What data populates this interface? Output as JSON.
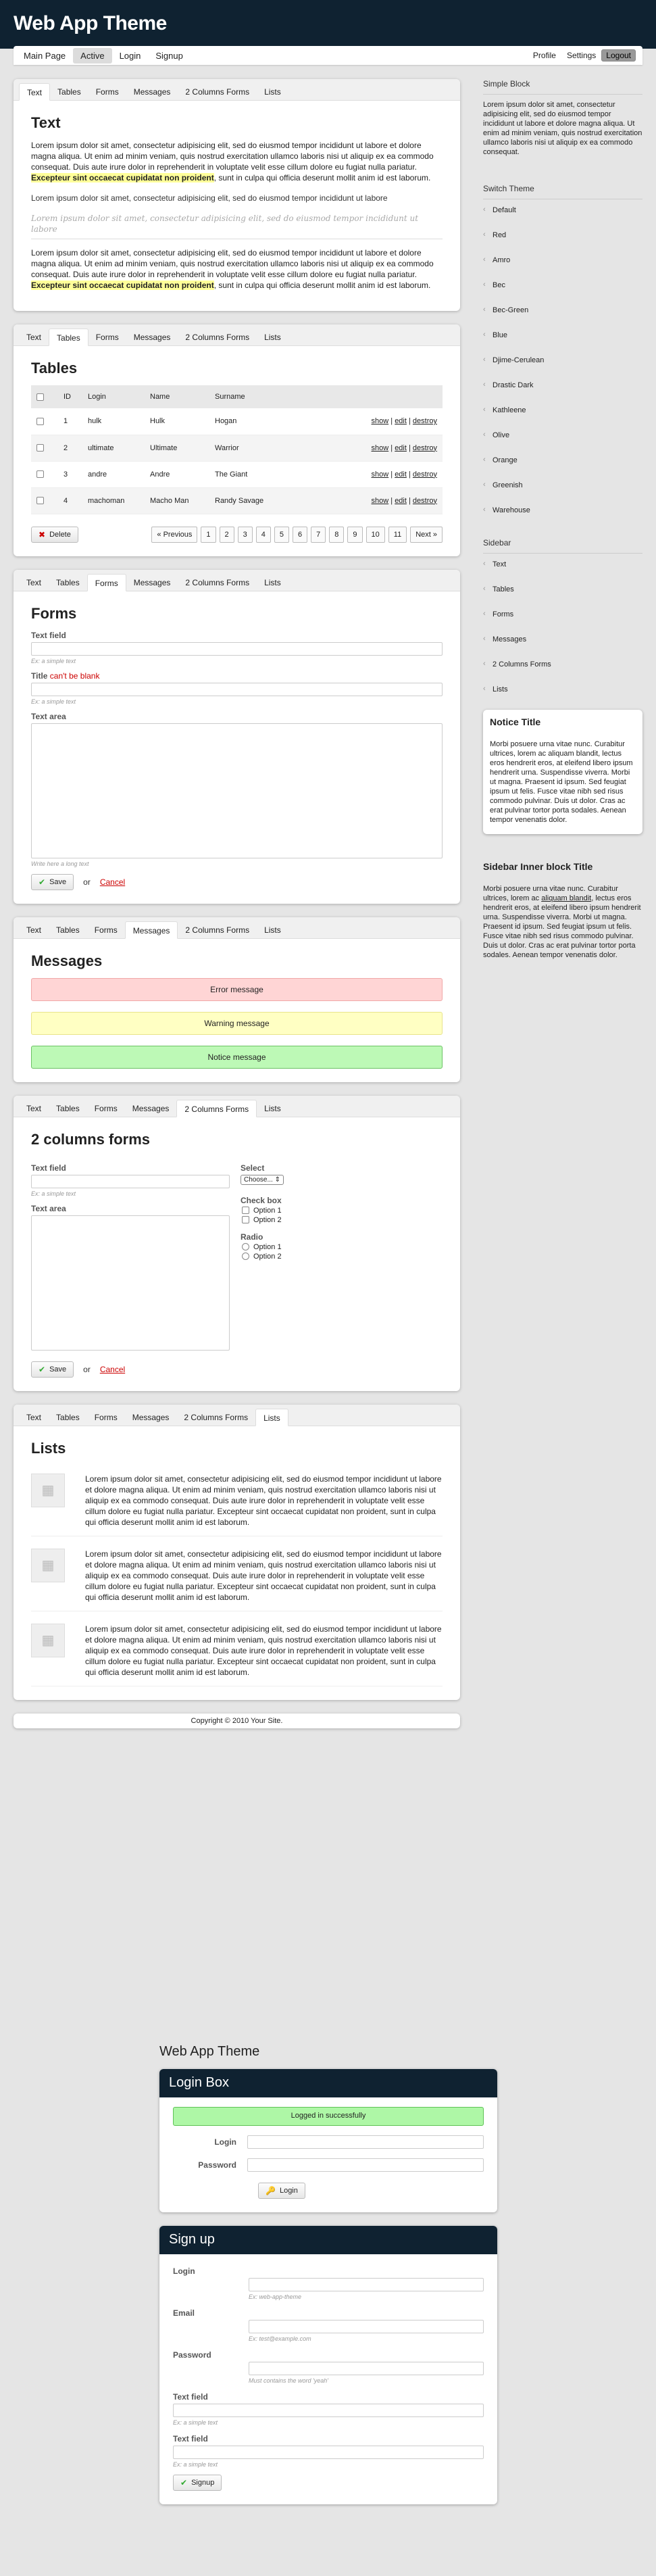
{
  "app_title": "Web App Theme",
  "topnav": {
    "items": [
      "Main Page",
      "Active",
      "Login",
      "Signup"
    ],
    "right": [
      "Profile",
      "Settings",
      "Logout"
    ]
  },
  "tabs": [
    "Text",
    "Tables",
    "Forms",
    "Messages",
    "2 Columns Forms",
    "Lists"
  ],
  "text_block": {
    "title": "Text",
    "p1a": "Lorem ipsum dolor sit amet, consectetur adipisicing elit, sed do eiusmod tempor incididunt ut labore et dolore magna aliqua. Ut enim ad minim veniam, quis nostrud exercitation ullamco laboris nisi ut aliquip ex ea commodo consequat. Duis aute irure dolor in reprehenderit in voluptate velit esse cillum dolore eu fugiat nulla pariatur. ",
    "p1hl": "Excepteur sint occaecat cupidatat non proident",
    "p1b": ", sunt in culpa qui officia deserunt mollit anim id est laborum.",
    "small": "Lorem ipsum dolor sit amet, consectetur adipisicing elit, sed do eiusmod tempor incididunt ut labore",
    "italic": "Lorem ipsum dolor sit amet, consectetur adipisicing elit, sed do eiusmod tempor incididunt ut labore",
    "p2a": "Lorem ipsum dolor sit amet, consectetur adipisicing elit, sed do eiusmod tempor incididunt ut labore et dolore magna aliqua. Ut enim ad minim veniam, quis nostrud exercitation ullamco laboris nisi ut aliquip ex ea commodo consequat. Duis aute irure dolor in reprehenderit in voluptate velit esse cillum dolore eu fugiat nulla pariatur. ",
    "p2hl": "Excepteur sint occaecat cupidatat non proident",
    "p2b": ", sunt in culpa qui officia deserunt mollit anim id est laborum."
  },
  "tables": {
    "title": "Tables",
    "headers": [
      "ID",
      "Login",
      "Name",
      "Surname"
    ],
    "rows": [
      [
        "1",
        "hulk",
        "Hulk",
        "Hogan"
      ],
      [
        "2",
        "ultimate",
        "Ultimate",
        "Warrior"
      ],
      [
        "3",
        "andre",
        "Andre",
        "The Giant"
      ],
      [
        "4",
        "machoman",
        "Macho Man",
        "Randy Savage"
      ]
    ],
    "actions": [
      "show",
      "edit",
      "destroy"
    ],
    "delete": "Delete",
    "pages": [
      "« Previous",
      "1",
      "2",
      "3",
      "4",
      "5",
      "6",
      "7",
      "8",
      "9",
      "10",
      "11",
      "Next »"
    ]
  },
  "forms": {
    "title": "Forms",
    "tf_label": "Text field",
    "tf_desc": "Ex: a simple text",
    "title_label": "Title",
    "title_err": "can't be blank",
    "title_desc": "Ex: a simple text",
    "ta_label": "Text area",
    "ta_desc": "Write here a long text",
    "save": "Save",
    "or": "or",
    "cancel": "Cancel"
  },
  "messages": {
    "title": "Messages",
    "error": "Error message",
    "warning": "Warning message",
    "notice": "Notice message"
  },
  "twocol": {
    "title": "2 columns forms",
    "tf_label": "Text field",
    "tf_desc": "Ex: a simple text",
    "ta_label": "Text area",
    "select_label": "Select",
    "select_value": "Choose... ⇕",
    "check_label": "Check box",
    "check_opts": [
      "Option 1",
      "Option 2"
    ],
    "radio_label": "Radio",
    "radio_opts": [
      "Option 1",
      "Option 2"
    ],
    "save": "Save",
    "or": "or",
    "cancel": "Cancel"
  },
  "lists": {
    "title": "Lists",
    "text": "Lorem ipsum dolor sit amet, consectetur adipisicing elit, sed do eiusmod tempor incididunt ut labore et dolore magna aliqua. Ut enim ad minim veniam, quis nostrud exercitation ullamco laboris nisi ut aliquip ex ea commodo consequat. Duis aute irure dolor in reprehenderit in voluptate velit esse cillum dolore eu fugiat nulla pariatur. Excepteur sint occaecat cupidatat non proident, sunt in culpa qui officia deserunt mollit anim id est laborum."
  },
  "footer": "Copyright © 2010 Your Site.",
  "sidebar": {
    "simple_title": "Simple Block",
    "simple_text": "Lorem ipsum dolor sit amet, consectetur adipisicing elit, sed do eiusmod tempor incididunt ut labore et dolore magna aliqua. Ut enim ad minim veniam, quis nostrud exercitation ullamco laboris nisi ut aliquip ex ea commodo consequat.",
    "switch_title": "Switch Theme",
    "themes": [
      "Default",
      "Red",
      "Amro",
      "Bec",
      "Bec-Green",
      "Blue",
      "Djime-Cerulean",
      "Drastic Dark",
      "Kathleene",
      "Olive",
      "Orange",
      "Greenish",
      "Warehouse"
    ],
    "sidebar_title": "Sidebar",
    "sidebar_items": [
      "Text",
      "Tables",
      "Forms",
      "Messages",
      "2 Columns Forms",
      "Lists"
    ],
    "notice_title": "Notice Title",
    "notice_text": "Morbi posuere urna vitae nunc. Curabitur ultrices, lorem ac aliquam blandit, lectus eros hendrerit eros, at eleifend libero ipsum hendrerit urna. Suspendisse viverra. Morbi ut magna. Praesent id ipsum. Sed feugiat ipsum ut felis. Fusce vitae nibh sed risus commodo pulvinar. Duis ut dolor. Cras ac erat pulvinar tortor porta sodales. Aenean tempor venenatis dolor.",
    "inner_title": "Sidebar Inner block Title",
    "inner_a": "Morbi posuere urna vitae nunc. Curabitur ultrices, lorem ac ",
    "inner_link": "aliquam blandit",
    "inner_b": ", lectus eros hendrerit eros, at eleifend libero ipsum hendrerit urna. Suspendisse viverra. Morbi ut magna. Praesent id ipsum. Sed feugiat ipsum ut felis. Fusce vitae nibh sed risus commodo pulvinar. Duis ut dolor. Cras ac erat pulvinar tortor porta sodales. Aenean tempor venenatis dolor."
  },
  "auth": {
    "title": "Web App Theme",
    "login_box": "Login Box",
    "logged": "Logged in successfully",
    "login": "Login",
    "password": "Password",
    "login_btn": "Login",
    "signup_box": "Sign up",
    "s_login": "Login",
    "s_login_desc": "Ex: web-app-theme",
    "s_email": "Email",
    "s_email_desc": "Ex: test@example.com",
    "s_password": "Password",
    "s_password_desc": "Must contains the word 'yeah'",
    "s_tf": "Text field",
    "s_tf_desc": "Ex: a simple text",
    "s_tf2": "Text field",
    "s_tf2_desc": "Ex: a simple text",
    "signup_btn": "Signup"
  }
}
